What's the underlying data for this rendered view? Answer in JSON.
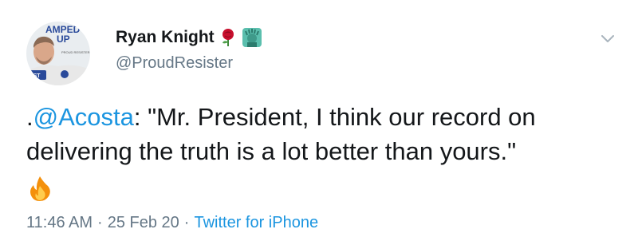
{
  "author": {
    "name": "Ryan Knight",
    "handle": "@ProudResister",
    "avatar_text_top": "AMPED",
    "avatar_text_mid": "UP",
    "avatar_text_small": "PROUD RESISTER",
    "avatar_text_corner": "SIST",
    "emojis": [
      "rose-emoji",
      "statue-of-liberty-emoji"
    ]
  },
  "tweet": {
    "prefix": ".",
    "mention": "@Acosta",
    "text_after_mention": ": \"Mr. President, I think our record on delivering the truth is a lot better than yours.\"",
    "trailing_emoji": "fire-emoji"
  },
  "meta": {
    "time": "11:46 AM",
    "separator": "·",
    "date": "25 Feb 20",
    "source": "Twitter for iPhone"
  },
  "colors": {
    "link": "#1b95e0",
    "secondary_text": "#657786",
    "primary_text": "#14171a"
  },
  "icons": {
    "menu": "chevron-down-icon"
  }
}
